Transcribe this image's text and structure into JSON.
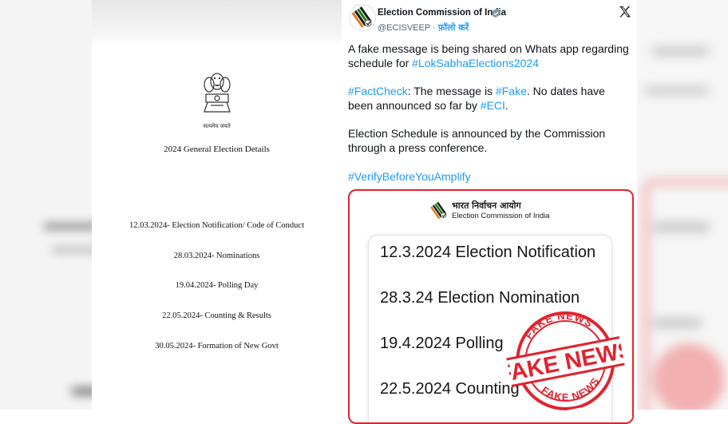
{
  "left_document": {
    "motto": "सत्यमेव जयते",
    "title": "2024 General Election Details",
    "schedule": [
      "12.03.2024- Election Notification/ Code of Conduct",
      "28.03.2024- Nominations",
      "19.04.2024- Polling Day",
      "22.05.2024- Counting & Results",
      "30.05.2024- Formation of New Govt"
    ]
  },
  "tweet": {
    "author_name": "Election Commission of India",
    "handle": "@ECISVEEP",
    "separator": " · ",
    "follow_label": "फ़ॉलो करें",
    "paragraph1": {
      "text": "A fake message is being shared on Whats app regarding schedule for ",
      "hashtag": "#LokSabhaElections2024"
    },
    "paragraph2": {
      "hashtag1": "#FactCheck",
      "text1": ": The message is ",
      "hashtag2": "#Fake",
      "text2": ". No dates have been announced so far by ",
      "hashtag3": "#ECI",
      "text3": "."
    },
    "paragraph3": "Election Schedule is announced by the Commission through a press conference.",
    "paragraph4": "#VerifyBeforeYouAmplify",
    "link_color": "#1d9bf0"
  },
  "embedded_image": {
    "header_hindi": "भारत निर्वाचन आयोग",
    "header_english": "Election Commission of India",
    "schedule": [
      "12.3.2024 Election Notification",
      "28.3.24 Election Nomination",
      "19.4.2024 Polling",
      "22.5.2024 Counting"
    ],
    "border_color": "#e0232e"
  },
  "stamp": {
    "text_top": "FAKE NEWS",
    "text_main": "FAKE NEWS",
    "text_bottom": "FAKE NEWS",
    "color": "#e0232e"
  },
  "icons": [
    "eci-logo-icon",
    "verified-badge-icon",
    "x-logo-icon",
    "national-emblem-icon"
  ]
}
